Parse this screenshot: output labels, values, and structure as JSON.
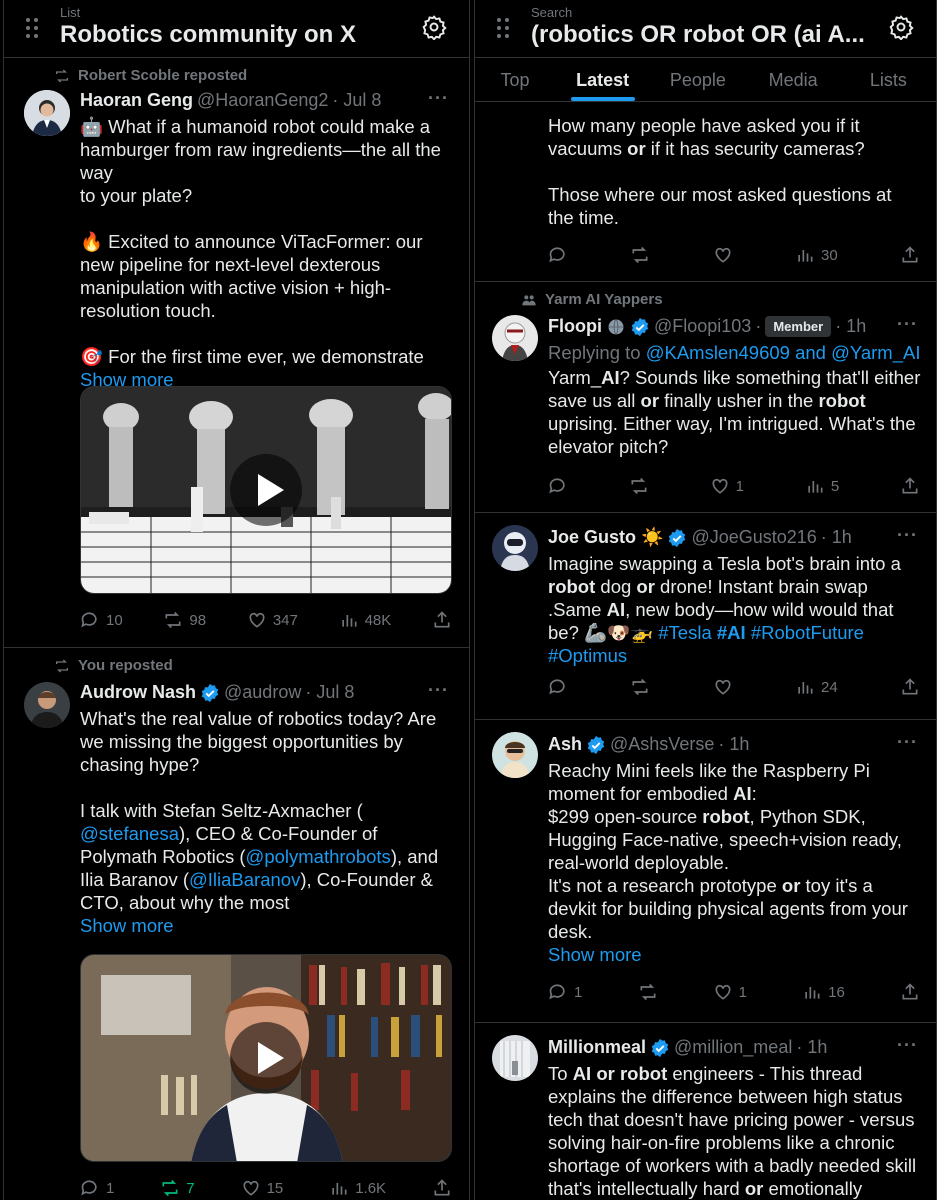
{
  "left": {
    "subtitle": "List",
    "title": "Robotics community on X",
    "tweets": [
      {
        "context": "Robert Scoble reposted",
        "name": "Haoran Geng",
        "handle": "@HaoranGeng2",
        "time": "· Jul 8",
        "text_lines": [
          "🤖 What if a humanoid robot could make a",
          "hamburger from raw ingredients—the all the way",
          "to your plate?",
          "",
          "🔥 Excited to announce ViTacFormer: our",
          "new pipeline for next-level dexterous",
          "manipulation with active vision + high-",
          "resolution touch.",
          "",
          "🎯 For the first time ever, we demonstrate"
        ],
        "show_more": "Show more",
        "replies": "10",
        "reposts": "98",
        "likes": "347",
        "views": "48K"
      },
      {
        "context": "You reposted",
        "name": "Audrow Nash",
        "handle": "@audrow",
        "time": "· Jul 8",
        "line1": "What's the real value of robotics today? Are",
        "line2": "we missing the biggest opportunities by",
        "line3": "chasing hype?",
        "line4a": "I talk with Stefan Seltz-Axmacher (",
        "mention1": "@stefanesa",
        "line5b": "), CEO & Co-Founder of",
        "line6a": "Polymath Robotics (",
        "mention2": "@polymathrobots",
        "line6b": "), and",
        "line7a": "Ilia Baranov (",
        "mention3": "@IliaBaranov",
        "line7b": "), Co-Founder &",
        "line8": "CTO, about why the most",
        "show_more": "Show more",
        "replies": "1",
        "reposts": "7",
        "likes": "15",
        "views": "1.6K"
      }
    ]
  },
  "right": {
    "subtitle": "Search",
    "title": "(robotics OR robot OR (ai A...",
    "tabs": [
      "Top",
      "Latest",
      "People",
      "Media",
      "Lists"
    ],
    "tweet0": {
      "l1": "How many people have asked you if it",
      "l2a": "vacuums ",
      "l2b": "or",
      "l2c": " if it has security cameras?",
      "l3": "Those where our most asked questions at",
      "l4": "the time.",
      "views": "30"
    },
    "tweet1": {
      "context": "Yarm AI Yappers",
      "name": "Floopi",
      "handle": "@Floopi103",
      "member": "Member",
      "time": "· 1h",
      "replying": "Replying to",
      "replying_to": "@KAmslen49609 and @Yarm_AI",
      "l1a": "Yarm_",
      "l1b": "AI",
      "l1c": "? Sounds like something that'll either",
      "l2a": "save us all ",
      "l2b": "or",
      "l2c": " finally usher in the ",
      "l2d": "robot",
      "l3": "uprising. Either way, I'm intrigued. What's the",
      "l4": "elevator pitch?",
      "likes": "1",
      "views": "5"
    },
    "tweet2": {
      "name": "Joe Gusto ☀️",
      "handle": "@JoeGusto216",
      "time": "· 1h",
      "l1": "Imagine swapping a Tesla bot's brain into a",
      "l2a": "robot",
      "l2b": " dog ",
      "l2c": "or",
      "l2d": " drone! Instant brain swap",
      "l3a": ".Same ",
      "l3b": "AI",
      "l3c": ", new body—how wild would that",
      "l4a": "be? 🦾🐶🚁 ",
      "l4b": "#Tesla",
      "l4c": "#AI",
      "l4d": "#RobotFuture",
      "l5": "#Optimus",
      "views": "24"
    },
    "tweet3": {
      "name": "Ash",
      "handle": "@AshsVerse",
      "time": "· 1h",
      "l1": "Reachy Mini feels like the Raspberry Pi",
      "l2a": "moment for embodied ",
      "l2b": "AI",
      "l2c": ":",
      "l3a": "$299 open-source ",
      "l3b": "robot",
      "l3c": ", Python SDK,",
      "l4": "Hugging Face-native, speech+vision ready,",
      "l5": "real-world deployable.",
      "l6a": "It's not a research prototype ",
      "l6b": "or",
      "l6c": " toy it's a",
      "l7": "devkit for building physical agents from your",
      "l8": "desk.",
      "show_more": "Show more",
      "replies": "1",
      "likes": "1",
      "views": "16"
    },
    "tweet4": {
      "name": "Millionmeal",
      "handle": "@million_meal",
      "time": "· 1h",
      "l1a": "To ",
      "l1b": "AI or robot",
      "l1c": " engineers - This thread",
      "l2": "explains the difference between high status",
      "l3": "tech that doesn't have pricing power - versus",
      "l4": "solving hair-on-fire problems like a chronic",
      "l5": "shortage of workers with a badly needed skill",
      "l6a": "that's intellectually hard ",
      "l6b": "or",
      "l6c": " emotionally"
    }
  },
  "colors": {
    "accent": "#1d9bf0",
    "muted": "#71767b",
    "text": "#e7e9ea",
    "repost_active": "#00ba7c",
    "border": "#2f3336"
  }
}
